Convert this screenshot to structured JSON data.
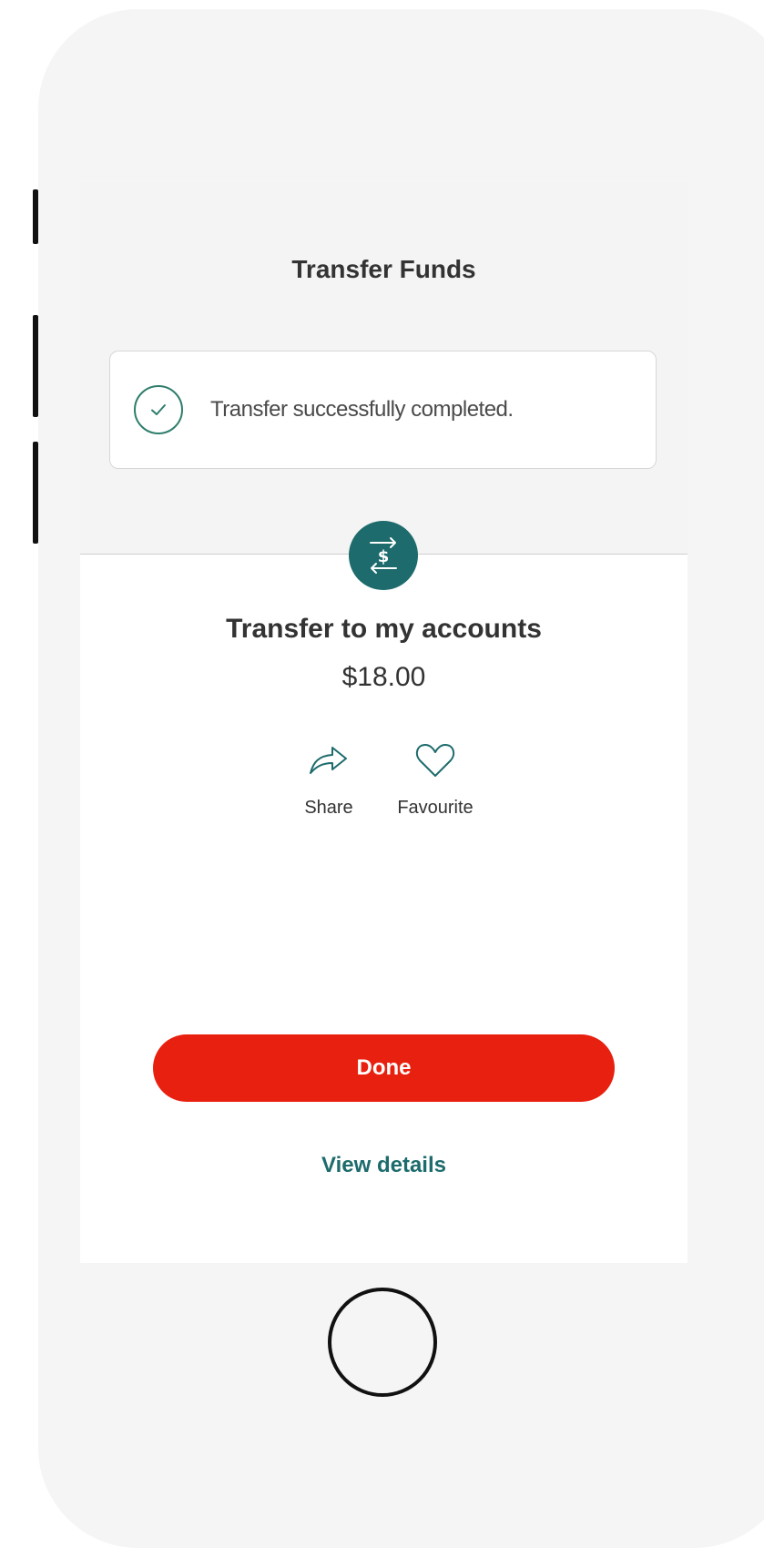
{
  "header": {
    "title": "Transfer Funds"
  },
  "alert": {
    "message": "Transfer successfully completed."
  },
  "transfer": {
    "title": "Transfer to my accounts",
    "amount": "$18.00"
  },
  "actions": [
    {
      "label": "Share",
      "icon": "share-icon"
    },
    {
      "label": "Favourite",
      "icon": "heart-icon"
    }
  ],
  "buttons": {
    "done_label": "Done",
    "view_details_label": "View details"
  },
  "colors": {
    "accent_teal": "#1d6b6c",
    "success_green": "#2e7d6b",
    "done_red": "#e8200f"
  }
}
